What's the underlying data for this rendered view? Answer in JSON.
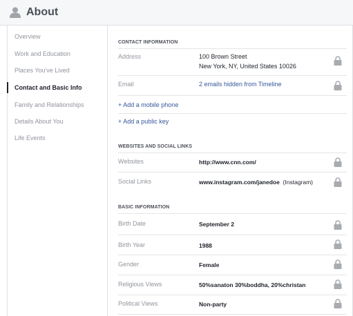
{
  "header": {
    "title": "About",
    "icon": "person-icon"
  },
  "sidebar": {
    "items": [
      {
        "label": "Overview",
        "active": false
      },
      {
        "label": "Work and Education",
        "active": false
      },
      {
        "label": "Places You've Lived",
        "active": false
      },
      {
        "label": "Contact and Basic Info",
        "active": true
      },
      {
        "label": "Family and Relationships",
        "active": false
      },
      {
        "label": "Details About You",
        "active": false
      },
      {
        "label": "Life Events",
        "active": false
      }
    ]
  },
  "contact": {
    "title": "CONTACT INFORMATION",
    "address": {
      "label": "Address",
      "line1": "100 Brown Street",
      "line2": "New York, NY, United States 10026"
    },
    "email": {
      "label": "Email",
      "value": "2 emails hidden from Timeline"
    },
    "add_phone": "+ Add a mobile phone",
    "add_key": "+ Add a public key"
  },
  "websites": {
    "title": "WEBSITES AND SOCIAL LINKS",
    "websites": {
      "label": "Websites",
      "value": "http://www.cnn.com/"
    },
    "social": {
      "label": "Social Links",
      "value": "www.instagram.com/janedoe",
      "suffix": "(Instagram)"
    }
  },
  "basic": {
    "title": "BASIC INFORMATION",
    "rows": [
      {
        "label": "Birth Date",
        "value": "September 2"
      },
      {
        "label": "Birth Year",
        "value": "1988"
      },
      {
        "label": "Gender",
        "value": "Female"
      },
      {
        "label": "Religious Views",
        "value": "50%sanaton 30%boddha, 20%christan"
      },
      {
        "label": "Political Views",
        "value": "Non-party"
      }
    ]
  },
  "colors": {
    "link": "#365899",
    "muted": "#90949c",
    "border": "#dddfe2",
    "lock": "#a8abb0"
  }
}
